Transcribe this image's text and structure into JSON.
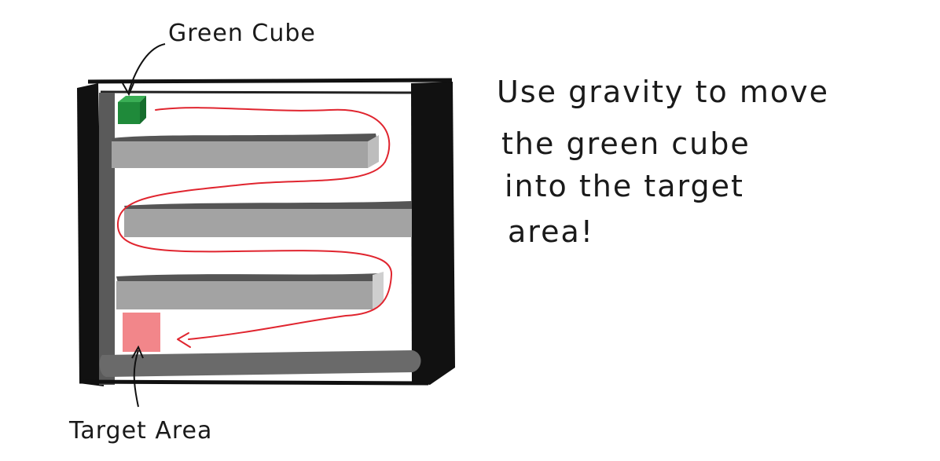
{
  "labels": {
    "green_cube": "Green Cube",
    "target_area": "Target Area"
  },
  "instruction": {
    "line1": "Use gravity to move",
    "line2": "the  green cube",
    "line3": "into  the  target",
    "line4": "area!"
  },
  "colors": {
    "frame": "#111111",
    "shelf_top": "#555555",
    "shelf_body": "#a3a3a3",
    "green_cube": "#1f8a3a",
    "target_area": "#f2868a",
    "path": "#e0252f"
  }
}
